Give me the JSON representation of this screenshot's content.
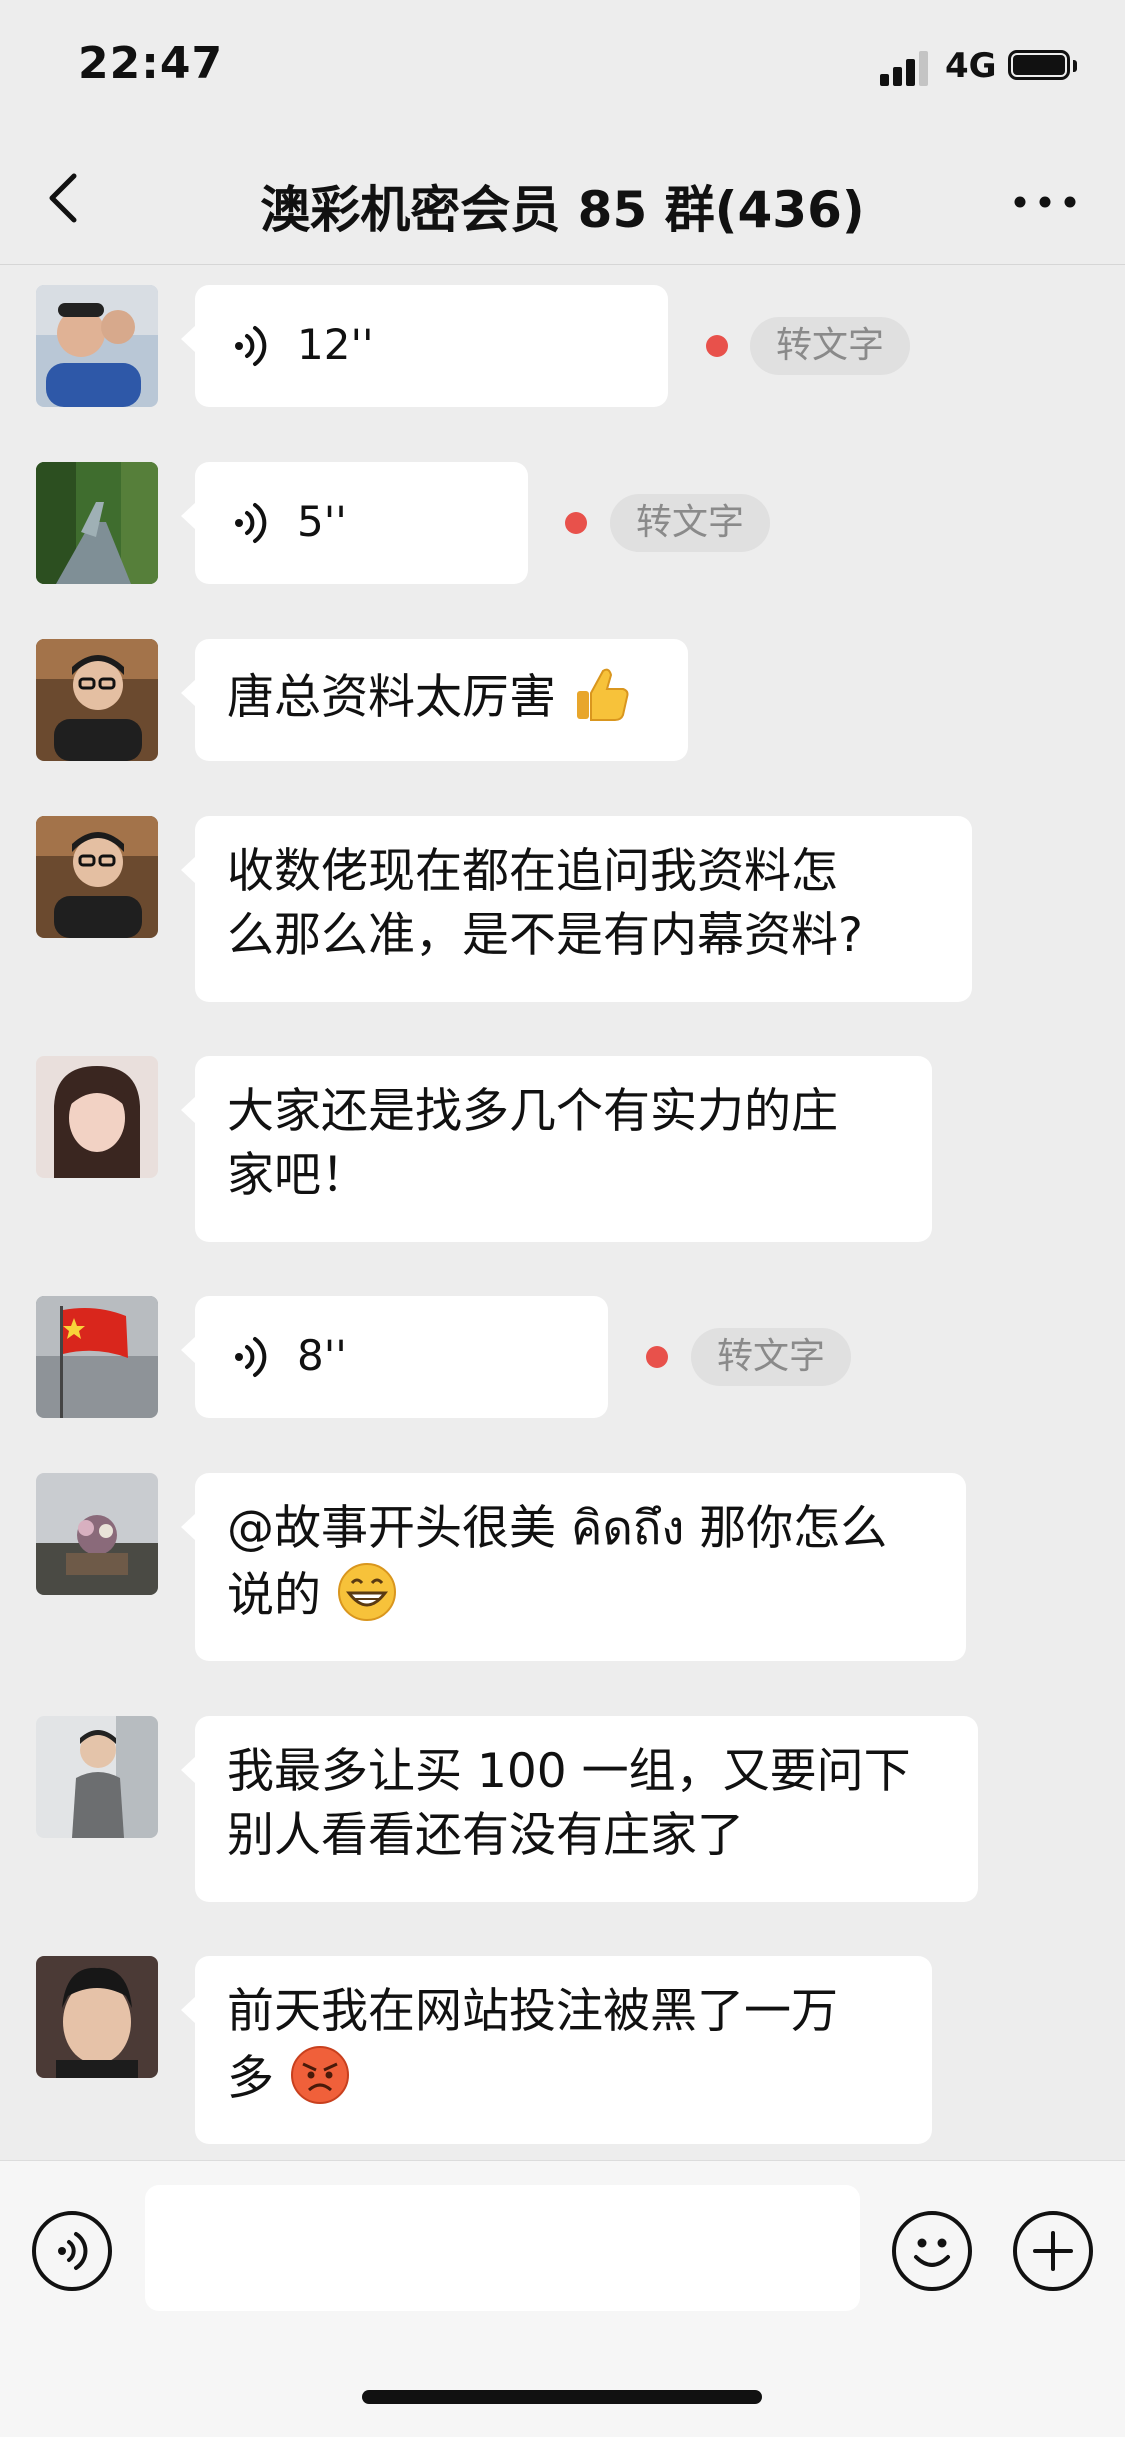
{
  "status_bar": {
    "time": "22:47",
    "network": "4G"
  },
  "header": {
    "title": "澳彩机密会员 85 群(436)"
  },
  "messages": [
    {
      "type": "voice",
      "duration": "12''",
      "convert_label": "转文字"
    },
    {
      "type": "voice",
      "duration": "5''",
      "convert_label": "转文字"
    },
    {
      "type": "text",
      "text": "唐总资料太厉害"
    },
    {
      "type": "text",
      "lines": [
        "收数佬现在都在追问我资料怎",
        "么那么准，是不是有内幕资料?"
      ]
    },
    {
      "type": "text",
      "lines": [
        "大家还是找多几个有实力的庄",
        "家吧！"
      ]
    },
    {
      "type": "voice",
      "duration": "8''",
      "convert_label": "转文字"
    },
    {
      "type": "text",
      "lines": [
        "@故事开头很美 คิดถึง 那你怎么",
        "说的"
      ]
    },
    {
      "type": "text",
      "lines": [
        "我最多让买 100 一组，又要问下",
        "别人看看还有没有庄家了"
      ]
    },
    {
      "type": "text",
      "lines": [
        "前天我在网站投注被黑了一万",
        "多"
      ]
    }
  ],
  "icons": {
    "back": "chevron-left-icon",
    "more": "more-dots-icon",
    "voice_input": "voice-input-icon",
    "emoji": "emoji-face-icon",
    "add": "plus-icon",
    "thumbs_up": "thumbs-up-emoji",
    "grin": "grin-emoji",
    "angry": "angry-emoji"
  },
  "colors": {
    "background": "#ededed",
    "bubble": "#ffffff",
    "unread_dot": "#e8514b",
    "stt_pill": "#e0e0e0"
  }
}
